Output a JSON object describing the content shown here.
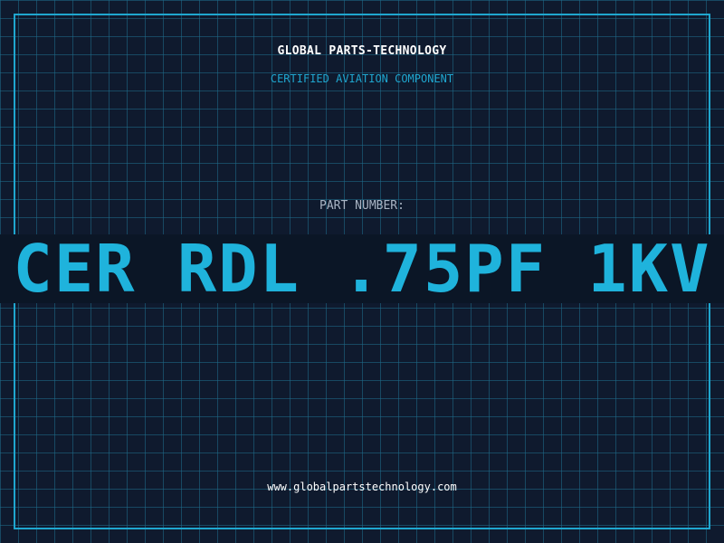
{
  "header": {
    "company": "GLOBAL PARTS-TECHNOLOGY",
    "tagline": "CERTIFIED AVIATION COMPONENT"
  },
  "part": {
    "label": "PART NUMBER:",
    "number": "CER RDL .75PF 1KV"
  },
  "footer": {
    "website": "www.globalpartstechnology.com"
  },
  "colors": {
    "background": "#0f1a2e",
    "grid": "#1e6e8c",
    "accent": "#1fa6cf",
    "part_text": "#1fb3dc",
    "label_text": "#a9b4c4"
  }
}
